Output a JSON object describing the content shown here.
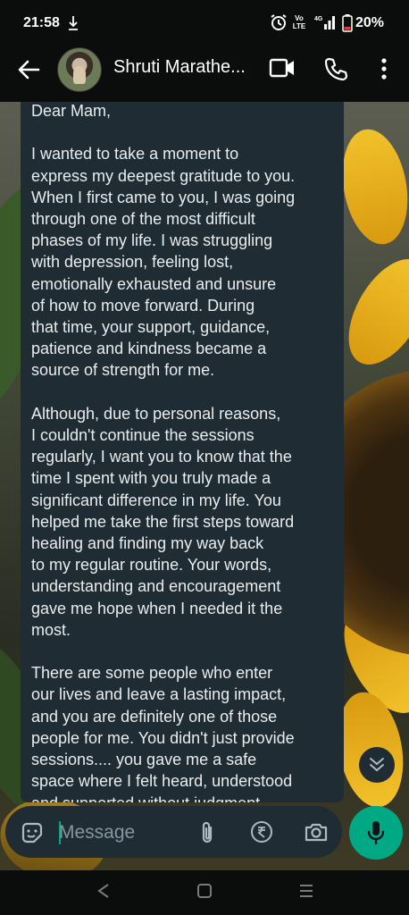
{
  "status_bar": {
    "time": "21:58",
    "network_label": "Vo LTE",
    "network_type": "4G",
    "battery": "20%",
    "icons": [
      "download-icon",
      "alarm-icon",
      "volte-icon",
      "signal-icon",
      "battery-icon"
    ]
  },
  "header": {
    "contact_name": "Shruti Marathe...",
    "icons": [
      "back-arrow-icon",
      "avatar",
      "video-call-icon",
      "phone-icon",
      "more-options-icon"
    ]
  },
  "message": {
    "text": "Dear Mam,\n\nI wanted to take a moment to\nexpress my deepest gratitude to you.\nWhen I first came to you, I was going\nthrough one of the most difficult\nphases of my life. I was struggling\nwith depression, feeling lost,\nemotionally exhausted and unsure\nof how to move forward. During\nthat time, your support, guidance,\npatience and kindness became a\nsource of strength for me.\n\nAlthough, due to personal reasons,\nI couldn't continue the sessions\nregularly, I want you to know that the\ntime I spent with you truly made a\nsignificant difference in my life. You\nhelped me take the first steps toward\nhealing and finding my way back\nto my regular routine. Your words,\nunderstanding and encouragement\ngave me hope when I needed it the\nmost.\n\nThere are some people who enter\nour lives and leave a lasting impact,\nand you are definitely one of those\npeople for me. You didn't just provide\nsessions.... you gave me a safe\nspace where I felt heard, understood\nand supported without judgment."
  },
  "input_bar": {
    "placeholder": "Message",
    "icons": [
      "sticker-icon",
      "attach-icon",
      "rupee-icon",
      "camera-icon",
      "mic-icon"
    ]
  },
  "nav_bar": {
    "icons": [
      "nav-back-icon",
      "nav-home-icon",
      "nav-recents-icon"
    ]
  },
  "colors": {
    "bubble": "#1f2c33",
    "accent": "#00a884",
    "background": "#0b0c0c",
    "text": "#e9edef",
    "placeholder": "#8696a0"
  }
}
